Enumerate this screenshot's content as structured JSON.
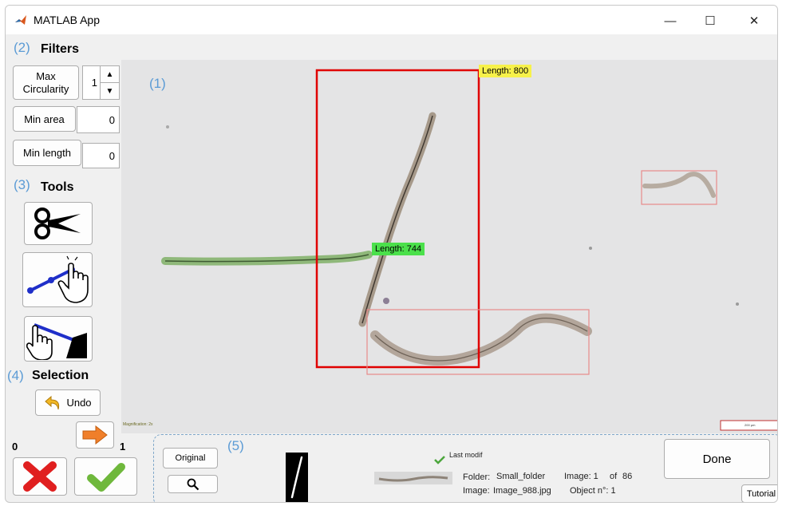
{
  "window": {
    "title": "MATLAB App",
    "minimize": "—",
    "maximize": "☐",
    "close": "✕"
  },
  "callouts": {
    "c1": "(1)",
    "c2": "(2)",
    "c3": "(3)",
    "c4": "(4)",
    "c5": "(5)"
  },
  "filters": {
    "heading": "Filters",
    "max_circularity_label": "Max Circularity",
    "max_circularity_value": "1",
    "min_area_label": "Min area",
    "min_area_value": "0",
    "min_length_label": "Min length",
    "min_length_value": "0"
  },
  "tools": {
    "heading": "Tools",
    "icons": [
      "scissors-icon",
      "draw-line-icon",
      "erase-line-icon"
    ]
  },
  "selection": {
    "heading": "Selection",
    "undo_label": "Undo"
  },
  "counts": {
    "rejected": "0",
    "accepted": "1"
  },
  "image": {
    "label_red": "Length: 800",
    "label_green": "Length: 744",
    "corner_text_left": "Magnification: 2x",
    "scalebar_text": "200 µm",
    "colors": {
      "red_box": "#e00000",
      "pale_box": "#e88a8a",
      "yellow": "#f7f14a",
      "green": "#4be04b"
    }
  },
  "bottom": {
    "original_label": "Original",
    "last_modif_label": "Last modif",
    "folder_label": "Folder:",
    "folder_value": "Small_folder",
    "image_label": "Image:",
    "image_value": "Image_988.jpg",
    "image_no_label": "Image: 1",
    "of_label": "of",
    "of_value": "86",
    "object_label": "Object n°: 1",
    "done_label": "Done",
    "tutorial_label": "Tutorial"
  }
}
